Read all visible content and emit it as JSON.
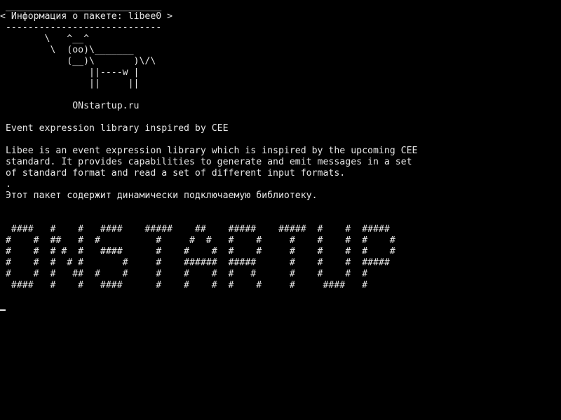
{
  "cowsay": {
    "top_border": " ____________________________",
    "title": "< Информация о пакете: libee0 >",
    "bottom_border": " ----------------------------",
    "cow": [
      "        \\   ^__^",
      "         \\  (oo)\\_______",
      "            (__)\\       )\\/\\",
      "                ||----w |",
      "                ||     ||"
    ]
  },
  "site": "             ONstartup.ru",
  "summary": " Event expression library inspired by CEE",
  "description": [
    " Libee is an event expression library which is inspired by the upcoming CEE",
    " standard. It provides capabilities to generate and emit messages in a set",
    " of standard format and read a set of different input formats.",
    " .",
    " Этот пакет содержит динамически подключаемую библиотеку."
  ],
  "banner": [
    "  ####   #    #   ####    #####    ##    #####    #####  #    #  #####",
    " #    #  ##   #  #          #     #  #   #    #     #    #    #  #    #",
    " #    #  # #  #   ####      #    #    #  #    #     #    #    #  #    #",
    " #    #  #  # #       #     #    ######  #####      #    #    #  #####",
    " #    #  #   ##  #    #     #    #    #  #   #      #    #    #  #",
    "  ####   #    #   ####      #    #    #  #    #     #     ####   #"
  ]
}
